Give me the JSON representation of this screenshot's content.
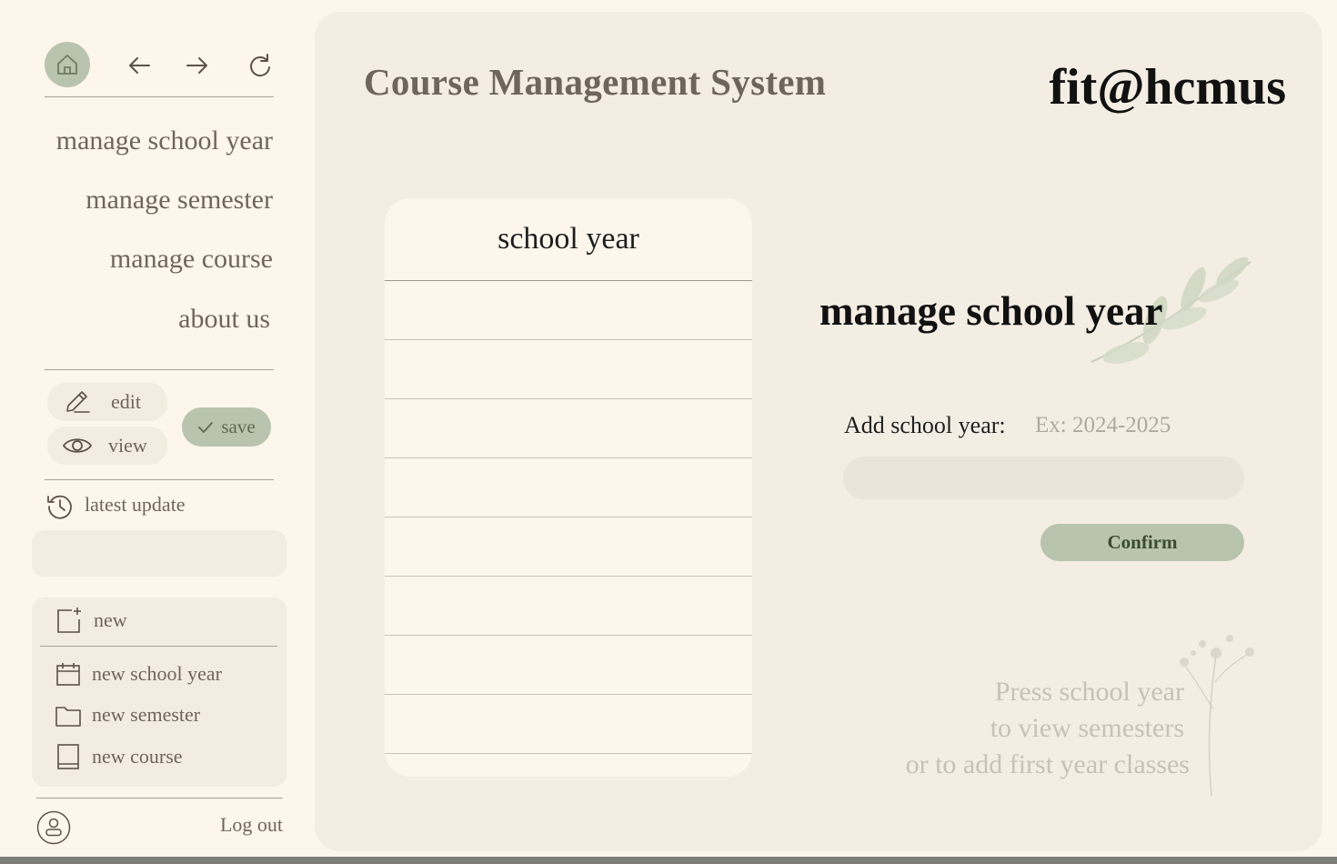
{
  "sidebar": {
    "nav": {
      "home_icon": "home-icon",
      "back_icon": "arrow-left-icon",
      "forward_icon": "arrow-right-icon",
      "refresh_icon": "refresh-icon"
    },
    "menu": [
      "manage school year",
      "manage semester",
      "manage course",
      "about us"
    ],
    "edit_label": "edit",
    "view_label": "view",
    "save_label": "save",
    "latest_update_label": "latest update",
    "new_panel": {
      "header": "new",
      "items": [
        "new school year",
        "new semester",
        "new course"
      ]
    },
    "logout_label": "Log out"
  },
  "header": {
    "app_title": "Course Management System",
    "brand": "fit@hcmus"
  },
  "year_list": {
    "header": "school year",
    "rows": [
      "",
      "",
      "",
      "",
      "",
      "",
      "",
      ""
    ]
  },
  "form": {
    "section_title": "manage school year",
    "add_label": "Add school year:",
    "input_placeholder": "Ex: 2024-2025",
    "input_value": "",
    "confirm_label": "Confirm"
  },
  "hint": {
    "line1": "Press school year",
    "line2": "to view semesters",
    "line3": "or to add first year classes"
  },
  "colors": {
    "background": "#fcf6ec",
    "panel": "#f3ede3",
    "accent_sage": "#b9c4ae",
    "text_muted": "#6f665b"
  }
}
